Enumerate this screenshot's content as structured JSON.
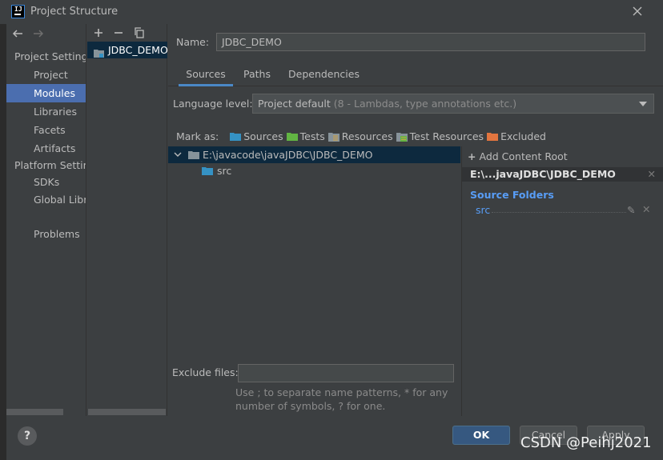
{
  "window": {
    "title": "Project Structure",
    "app_icon_text": "IJ"
  },
  "nav": {
    "sections": [
      {
        "label": "Project Settings",
        "items": [
          "Project",
          "Modules",
          "Libraries",
          "Facets",
          "Artifacts"
        ]
      },
      {
        "label": "Platform Settings",
        "items": [
          "SDKs",
          "Global Libraries"
        ]
      }
    ],
    "selected": "Modules",
    "problems": "Problems"
  },
  "modules": {
    "toolbar": [
      "add-icon",
      "remove-icon",
      "copy-icon"
    ],
    "items": [
      "JDBC_DEMO"
    ]
  },
  "main": {
    "name_label": "Name:",
    "name_value": "JDBC_DEMO",
    "tabs": [
      "Sources",
      "Paths",
      "Dependencies"
    ],
    "selected_tab": "Sources",
    "language_level_label": "Language level:",
    "language_level_value": "Project default",
    "language_level_hint": "(8 - Lambdas, type annotations etc.)",
    "mark_as_label": "Mark as:",
    "mark_as": [
      "Sources",
      "Tests",
      "Resources",
      "Test Resources",
      "Excluded"
    ],
    "tree": {
      "root": "E:\\javacode\\javaJDBC\\JDBC_DEMO",
      "children": [
        "src"
      ]
    },
    "exclude_label": "Exclude files:",
    "exclude_value": "",
    "exclude_help_1": "Use ; to separate name patterns, * for any",
    "exclude_help_2": "number of symbols, ? for one."
  },
  "content_root": {
    "add_label": "Add Content Root",
    "root": "E:\\...javaJDBC\\JDBC_DEMO",
    "source_folders_title": "Source Folders",
    "source_folders": [
      "src"
    ]
  },
  "buttons": {
    "help": "?",
    "ok": "OK",
    "cancel": "Cancel",
    "apply": "Apply"
  },
  "watermark": "CSDN @Peihj2021",
  "colors": {
    "background": "#3c3f41",
    "selection": "#4b6eaf",
    "tree_selection": "#0d293e",
    "accent": "#589df6",
    "ok_button": "#365880"
  }
}
